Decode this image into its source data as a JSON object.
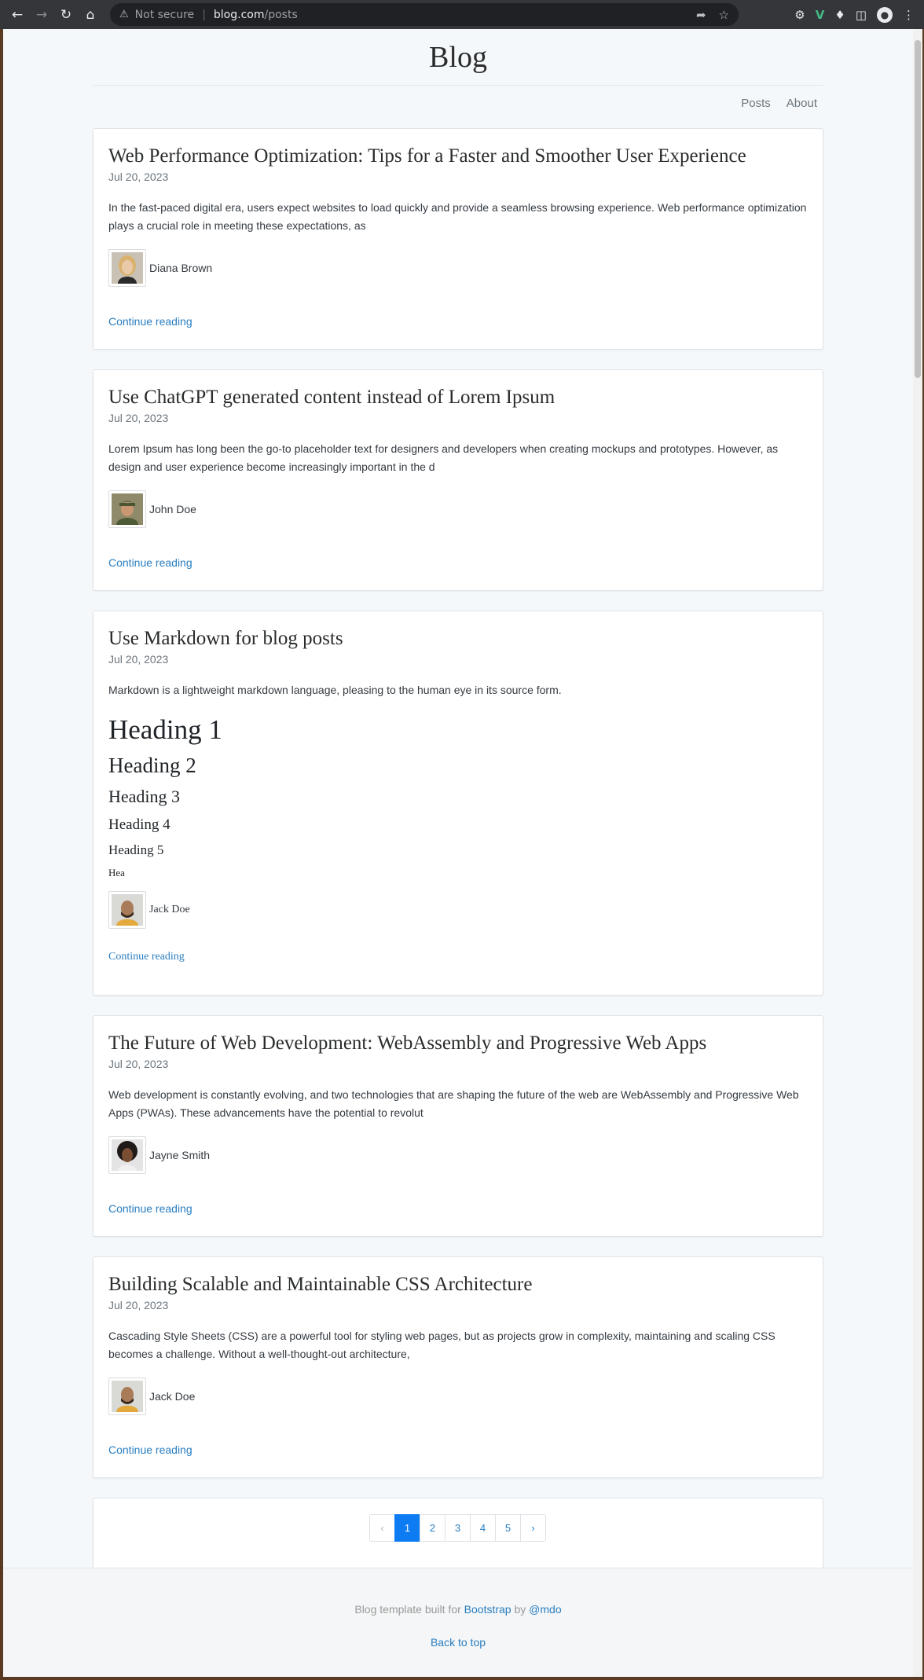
{
  "browser": {
    "security_label": "Not secure",
    "url_host": "blog.com",
    "url_path": "/posts"
  },
  "blog": {
    "title": "Blog",
    "nav": [
      "Posts",
      "About"
    ]
  },
  "posts": [
    {
      "title": "Web Performance Optimization: Tips for a Faster and Smoother User Experience",
      "date": "Jul 20, 2023",
      "excerpt": "In the fast-paced digital era, users expect websites to load quickly and provide a seamless browsing experience. Web performance optimization plays a crucial role in meeting these expectations, as",
      "author": "Diana Brown",
      "continue": "Continue reading"
    },
    {
      "title": "Use ChatGPT generated content instead of Lorem Ipsum",
      "date": "Jul 20, 2023",
      "excerpt": "Lorem Ipsum has long been the go-to placeholder text for designers and developers when creating mockups and prototypes. However, as design and user experience become increasingly important in the d",
      "author": "John Doe",
      "continue": "Continue reading"
    },
    {
      "title": "Use Markdown for blog posts",
      "date": "Jul 20, 2023",
      "excerpt": "Markdown is a lightweight markdown language, pleasing to the human eye in its source form.",
      "headings": [
        "Heading 1",
        "Heading 2",
        "Heading 3",
        "Heading 4",
        "Heading 5",
        "Hea"
      ],
      "author": "Jack Doe",
      "continue": "Continue reading"
    },
    {
      "title": "The Future of Web Development: WebAssembly and Progressive Web Apps",
      "date": "Jul 20, 2023",
      "excerpt": "Web development is constantly evolving, and two technologies that are shaping the future of the web are WebAssembly and Progressive Web Apps (PWAs). These advancements have the potential to revolut",
      "author": "Jayne Smith",
      "continue": "Continue reading"
    },
    {
      "title": "Building Scalable and Maintainable CSS Architecture",
      "date": "Jul 20, 2023",
      "excerpt": "Cascading Style Sheets (CSS) are a powerful tool for styling web pages, but as projects grow in complexity, maintaining and scaling CSS becomes a challenge. Without a well-thought-out architecture,",
      "author": "Jack Doe",
      "continue": "Continue reading"
    }
  ],
  "pagination": {
    "prev": "‹",
    "pages": [
      "1",
      "2",
      "3",
      "4",
      "5"
    ],
    "next": "›",
    "current": "1"
  },
  "footer": {
    "prefix": "Blog template built for",
    "bootstrap": "Bootstrap",
    "by": "by",
    "mdo": "@mdo",
    "back_to_top": "Back to top"
  },
  "colors": {
    "link": "#2a7ec0",
    "active_page": "#0d7bf2"
  }
}
